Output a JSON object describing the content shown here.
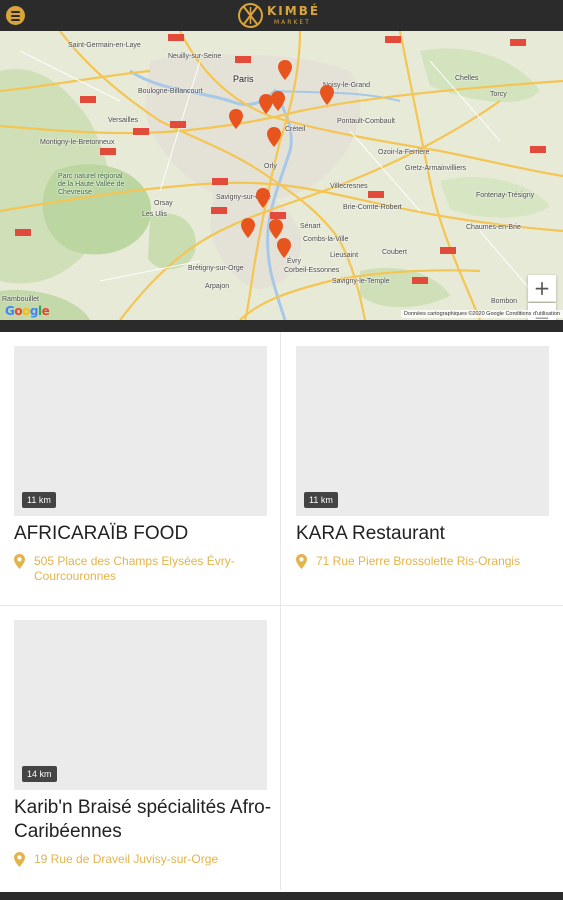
{
  "header": {
    "menu_icon": "hamburger-icon",
    "logo_word": "KIMBÉ",
    "logo_sub": "MARKET",
    "colors": {
      "bar": "#2b2b2b",
      "accent": "#d9a43a"
    }
  },
  "map": {
    "labels": {
      "saint_germain": "Saint-Germain-en-Laye",
      "neuilly": "Neuilly-sur-Seine",
      "paris": "Paris",
      "boulogne": "Boulogne-Billancourt",
      "noisy": "Noisy-le-Grand",
      "versailles": "Versailles",
      "creteil": "Créteil",
      "pontault": "Pontault-Combault",
      "montigny": "Montigny-le-Bretonneux",
      "orly": "Orly",
      "ozoir": "Ozoir-la-Ferrière",
      "gretz": "Gretz-Armainvilliers",
      "parc": "Parc naturel régional de la Haute Vallée de Chevreuse",
      "brie": "Brie-Comte-Robert",
      "les_ulis": "Les Ulis",
      "orsay": "Orsay",
      "savigny_orge": "Savigny-sur-Orge",
      "combs": "Combs-la-Ville",
      "lieusaint": "Lieusaint",
      "sénart": "Sénart",
      "bretigny": "Brétigny-sur-Orge",
      "corbeil": "Corbeil-Essonnes",
      "savigny_temple": "Savigny-le-Temple",
      "arpajon": "Arpajon",
      "rambouillet": "Rambouillet",
      "chelles": "Chelles",
      "torcy": "Torcy",
      "fontenay": "Fontenay-Trésigny",
      "chaumes": "Chaumes-en-Brie",
      "coubert": "Coubert",
      "bombon": "Bombon",
      "villecresnes": "Villecresnes",
      "evry": "Évry"
    },
    "zoom_in": "+",
    "zoom_out": "−",
    "google": "Google",
    "attribution": "Données cartographiques ©2020 Google    Conditions d'utilisation",
    "pin_color": "#e8541e",
    "pin_icon": "map-marker-icon"
  },
  "restaurants": [
    {
      "name": "AFRICARAÏB FOOD",
      "address": "505 Place des Champs Elysées Évry-Courcouronnes",
      "distance": "11 km"
    },
    {
      "name": "KARA Restaurant",
      "address": "71 Rue Pierre Brossolette Ris-Orangis",
      "distance": "11 km"
    },
    {
      "name": "Karib'n Braisé spécialités Afro-Caribéennes",
      "address": "19 Rue de Draveil Juvisy-sur-Orge",
      "distance": "14 km"
    }
  ]
}
